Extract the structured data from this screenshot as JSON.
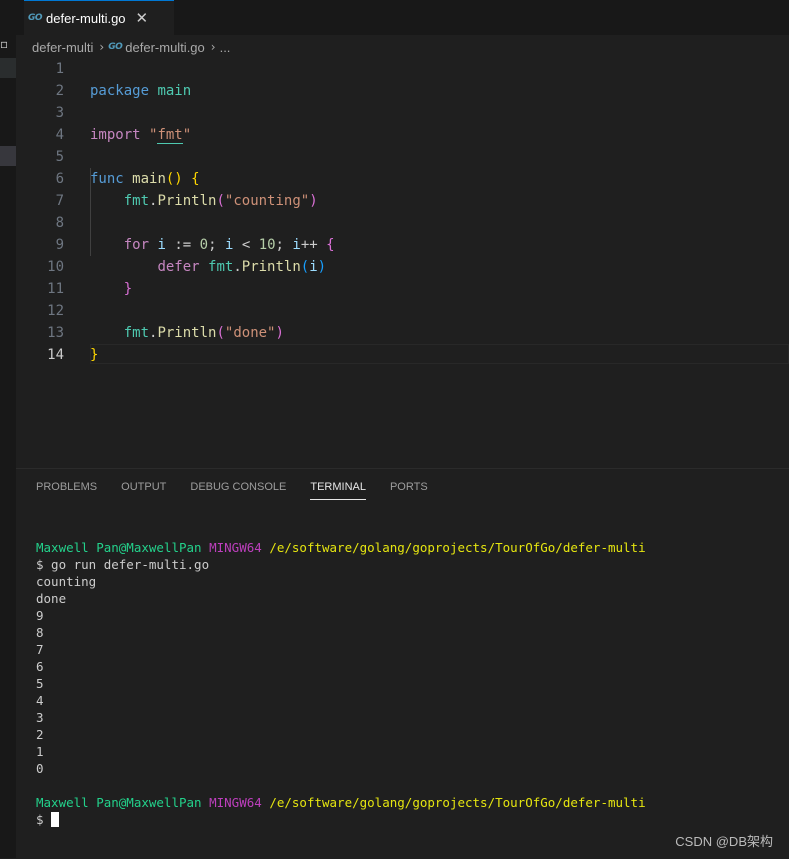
{
  "tab": {
    "icon": "GO",
    "label": "defer-multi.go",
    "close": "✕"
  },
  "breadcrumb": {
    "folder": "defer-multi",
    "sep": "›",
    "icon": "GO",
    "file": "defer-multi.go",
    "sep2": "›",
    "ellipsis": "..."
  },
  "editor": {
    "line_numbers": [
      "1",
      "2",
      "3",
      "4",
      "5",
      "6",
      "7",
      "8",
      "9",
      "10",
      "11",
      "12",
      "13",
      "14"
    ],
    "active_line": "14",
    "code": {
      "l1": {
        "kw": "package",
        "name": "main"
      },
      "l3": {
        "kw": "import",
        "q1": "\"",
        "pkg": "fmt",
        "q2": "\""
      },
      "l5": {
        "kw": "func",
        "name": "main",
        "parens": "()",
        "brace": "{"
      },
      "l6": {
        "pkg": "fmt",
        "dot": ".",
        "fn": "Println",
        "open": "(",
        "str": "\"counting\"",
        "close": ")"
      },
      "l8": {
        "kw": "for",
        "i1": "i",
        "op1": ":=",
        "n0": "0",
        "semi1": ";",
        "i2": "i",
        "op2": "<",
        "n10": "10",
        "semi2": ";",
        "i3": "i",
        "op3": "++",
        "brace": "{"
      },
      "l9": {
        "kw": "defer",
        "pkg": "fmt",
        "dot": ".",
        "fn": "Println",
        "open": "(",
        "arg": "i",
        "close": ")"
      },
      "l10": {
        "brace": "}"
      },
      "l12": {
        "pkg": "fmt",
        "dot": ".",
        "fn": "Println",
        "open": "(",
        "str": "\"done\"",
        "close": ")"
      },
      "l13": {
        "brace": "}"
      }
    }
  },
  "panel": {
    "tabs": [
      "PROBLEMS",
      "OUTPUT",
      "DEBUG CONSOLE",
      "TERMINAL",
      "PORTS"
    ],
    "active_tab": "TERMINAL"
  },
  "terminal": {
    "prompt": {
      "user": "Maxwell Pan@MaxwellPan",
      "env": "MINGW64",
      "path": "/e/software/golang/goprojects/TourOfGo/defer-multi"
    },
    "command": "$ go run defer-multi.go",
    "output": [
      "counting",
      "done",
      "9",
      "8",
      "7",
      "6",
      "5",
      "4",
      "3",
      "2",
      "1",
      "0"
    ],
    "prompt_symbol": "$"
  },
  "watermark": "CSDN @DB架构",
  "colors": {
    "keyword": "#569cd6",
    "control": "#c586c0",
    "function": "#dcdcaa",
    "package": "#4ec9b0",
    "string": "#ce9178",
    "number": "#b5cea8",
    "term_green": "#23d18b",
    "term_purple": "#bc3fbc",
    "term_yellow": "#e5e510"
  }
}
